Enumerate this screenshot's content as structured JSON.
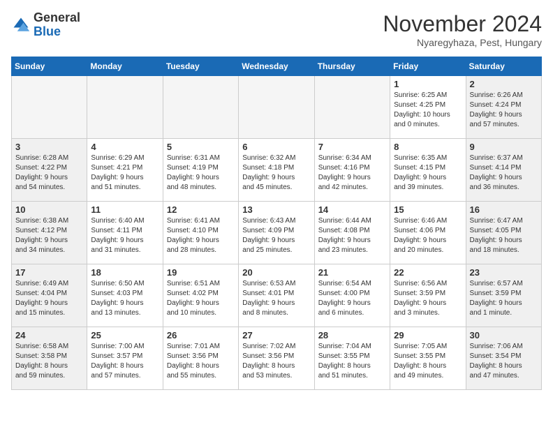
{
  "logo": {
    "general": "General",
    "blue": "Blue"
  },
  "header": {
    "month": "November 2024",
    "location": "Nyaregyhaza, Pest, Hungary"
  },
  "weekdays": [
    "Sunday",
    "Monday",
    "Tuesday",
    "Wednesday",
    "Thursday",
    "Friday",
    "Saturday"
  ],
  "weeks": [
    [
      {
        "day": "",
        "info": ""
      },
      {
        "day": "",
        "info": ""
      },
      {
        "day": "",
        "info": ""
      },
      {
        "day": "",
        "info": ""
      },
      {
        "day": "",
        "info": ""
      },
      {
        "day": "1",
        "info": "Sunrise: 6:25 AM\nSunset: 4:25 PM\nDaylight: 10 hours\nand 0 minutes."
      },
      {
        "day": "2",
        "info": "Sunrise: 6:26 AM\nSunset: 4:24 PM\nDaylight: 9 hours\nand 57 minutes."
      }
    ],
    [
      {
        "day": "3",
        "info": "Sunrise: 6:28 AM\nSunset: 4:22 PM\nDaylight: 9 hours\nand 54 minutes."
      },
      {
        "day": "4",
        "info": "Sunrise: 6:29 AM\nSunset: 4:21 PM\nDaylight: 9 hours\nand 51 minutes."
      },
      {
        "day": "5",
        "info": "Sunrise: 6:31 AM\nSunset: 4:19 PM\nDaylight: 9 hours\nand 48 minutes."
      },
      {
        "day": "6",
        "info": "Sunrise: 6:32 AM\nSunset: 4:18 PM\nDaylight: 9 hours\nand 45 minutes."
      },
      {
        "day": "7",
        "info": "Sunrise: 6:34 AM\nSunset: 4:16 PM\nDaylight: 9 hours\nand 42 minutes."
      },
      {
        "day": "8",
        "info": "Sunrise: 6:35 AM\nSunset: 4:15 PM\nDaylight: 9 hours\nand 39 minutes."
      },
      {
        "day": "9",
        "info": "Sunrise: 6:37 AM\nSunset: 4:14 PM\nDaylight: 9 hours\nand 36 minutes."
      }
    ],
    [
      {
        "day": "10",
        "info": "Sunrise: 6:38 AM\nSunset: 4:12 PM\nDaylight: 9 hours\nand 34 minutes."
      },
      {
        "day": "11",
        "info": "Sunrise: 6:40 AM\nSunset: 4:11 PM\nDaylight: 9 hours\nand 31 minutes."
      },
      {
        "day": "12",
        "info": "Sunrise: 6:41 AM\nSunset: 4:10 PM\nDaylight: 9 hours\nand 28 minutes."
      },
      {
        "day": "13",
        "info": "Sunrise: 6:43 AM\nSunset: 4:09 PM\nDaylight: 9 hours\nand 25 minutes."
      },
      {
        "day": "14",
        "info": "Sunrise: 6:44 AM\nSunset: 4:08 PM\nDaylight: 9 hours\nand 23 minutes."
      },
      {
        "day": "15",
        "info": "Sunrise: 6:46 AM\nSunset: 4:06 PM\nDaylight: 9 hours\nand 20 minutes."
      },
      {
        "day": "16",
        "info": "Sunrise: 6:47 AM\nSunset: 4:05 PM\nDaylight: 9 hours\nand 18 minutes."
      }
    ],
    [
      {
        "day": "17",
        "info": "Sunrise: 6:49 AM\nSunset: 4:04 PM\nDaylight: 9 hours\nand 15 minutes."
      },
      {
        "day": "18",
        "info": "Sunrise: 6:50 AM\nSunset: 4:03 PM\nDaylight: 9 hours\nand 13 minutes."
      },
      {
        "day": "19",
        "info": "Sunrise: 6:51 AM\nSunset: 4:02 PM\nDaylight: 9 hours\nand 10 minutes."
      },
      {
        "day": "20",
        "info": "Sunrise: 6:53 AM\nSunset: 4:01 PM\nDaylight: 9 hours\nand 8 minutes."
      },
      {
        "day": "21",
        "info": "Sunrise: 6:54 AM\nSunset: 4:00 PM\nDaylight: 9 hours\nand 6 minutes."
      },
      {
        "day": "22",
        "info": "Sunrise: 6:56 AM\nSunset: 3:59 PM\nDaylight: 9 hours\nand 3 minutes."
      },
      {
        "day": "23",
        "info": "Sunrise: 6:57 AM\nSunset: 3:59 PM\nDaylight: 9 hours\nand 1 minute."
      }
    ],
    [
      {
        "day": "24",
        "info": "Sunrise: 6:58 AM\nSunset: 3:58 PM\nDaylight: 8 hours\nand 59 minutes."
      },
      {
        "day": "25",
        "info": "Sunrise: 7:00 AM\nSunset: 3:57 PM\nDaylight: 8 hours\nand 57 minutes."
      },
      {
        "day": "26",
        "info": "Sunrise: 7:01 AM\nSunset: 3:56 PM\nDaylight: 8 hours\nand 55 minutes."
      },
      {
        "day": "27",
        "info": "Sunrise: 7:02 AM\nSunset: 3:56 PM\nDaylight: 8 hours\nand 53 minutes."
      },
      {
        "day": "28",
        "info": "Sunrise: 7:04 AM\nSunset: 3:55 PM\nDaylight: 8 hours\nand 51 minutes."
      },
      {
        "day": "29",
        "info": "Sunrise: 7:05 AM\nSunset: 3:55 PM\nDaylight: 8 hours\nand 49 minutes."
      },
      {
        "day": "30",
        "info": "Sunrise: 7:06 AM\nSunset: 3:54 PM\nDaylight: 8 hours\nand 47 minutes."
      }
    ]
  ]
}
